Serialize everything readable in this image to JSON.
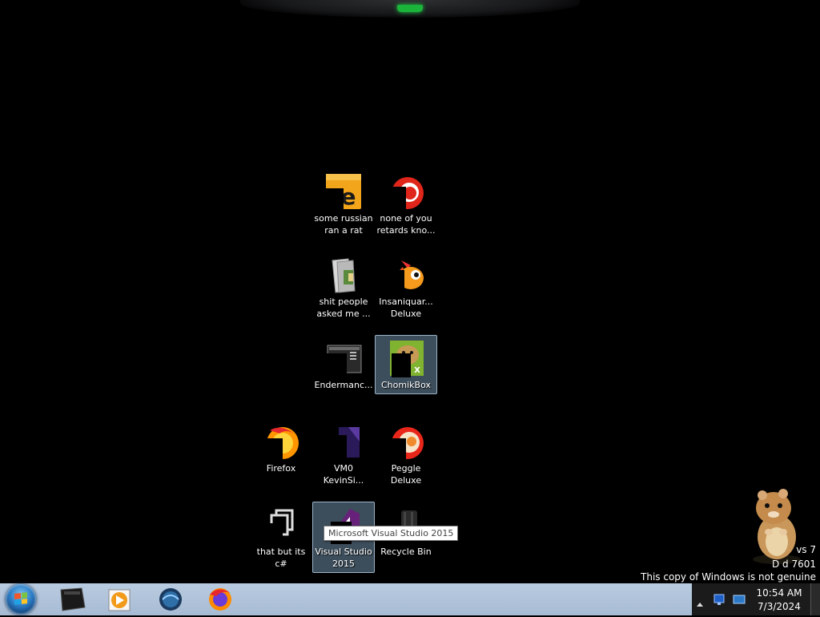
{
  "desktop": {
    "icons": [
      {
        "label": "some russian\nran a rat"
      },
      {
        "label": "none of you\nretards kno..."
      },
      {
        "label": "shit people\nasked me ..."
      },
      {
        "label": "Insaniquar...\nDeluxe"
      },
      {
        "label": "Endermanc..."
      },
      {
        "label": "ChomikBox"
      },
      {
        "label": "Firefox"
      },
      {
        "label": "VM0\nKevinSi..."
      },
      {
        "label": "Peggle Deluxe"
      },
      {
        "label": "that but its c#"
      },
      {
        "label": "Visual Studio\n2015"
      },
      {
        "label": "Recycle Bin"
      }
    ],
    "tooltip": "Microsoft Visual Studio 2015",
    "selected_icon": "ChomikBox"
  },
  "watermark": {
    "line1": "vs 7",
    "line2": "D  d 7601",
    "line3": "This copy of Windows is not genuine"
  },
  "taskbar": {
    "pinned": [
      "monitor-app-icon",
      "media-player-icon",
      "browser-globe-icon",
      "firefox-icon"
    ],
    "clock_time": "10:54 AM",
    "clock_date": "7/3/2024"
  },
  "colors": {
    "taskbar": "#a7bbd4",
    "accent_green": "#1bb43a",
    "selection": "#6e8ca5"
  }
}
